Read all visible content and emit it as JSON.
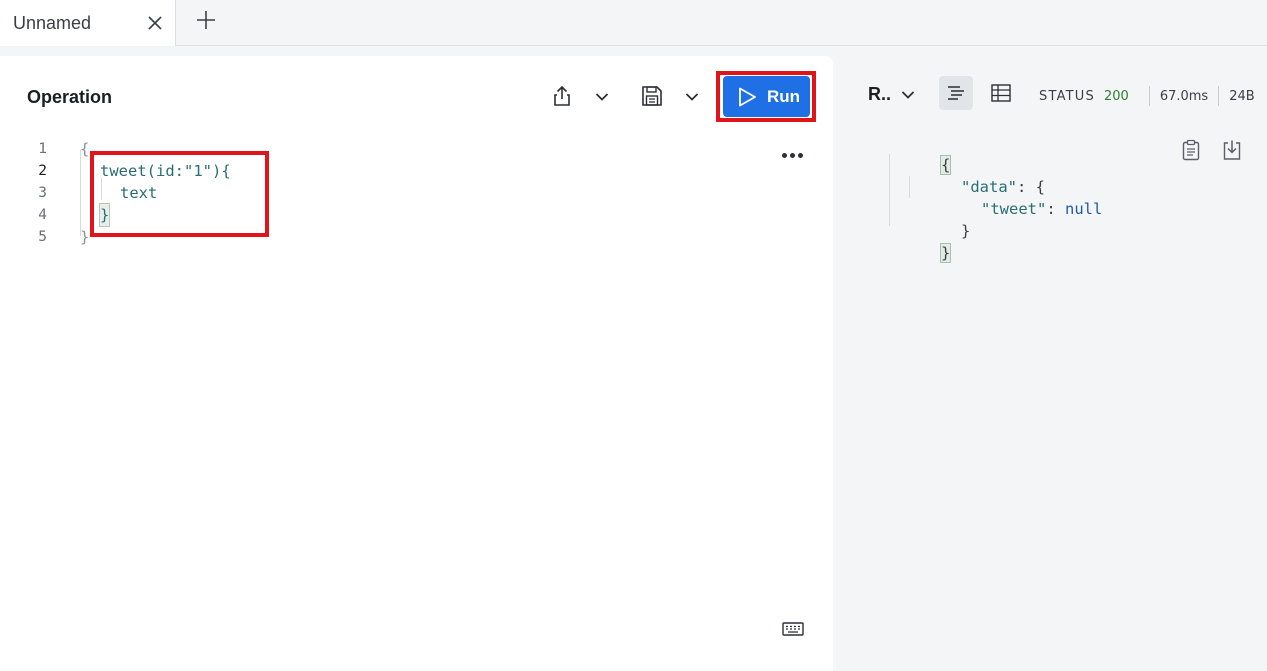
{
  "tabs": [
    {
      "title": "Unnamed",
      "active": true
    }
  ],
  "operation": {
    "title": "Operation",
    "run_label": "Run",
    "lines": [
      {
        "num": "1",
        "text": "{"
      },
      {
        "num": "2",
        "text": "tweet(id:\"1\"){"
      },
      {
        "num": "3",
        "text": "text"
      },
      {
        "num": "4",
        "text": "}"
      },
      {
        "num": "5",
        "text": "}"
      }
    ]
  },
  "response": {
    "selector_label": "R..",
    "status_label": "STATUS",
    "status_code": "200",
    "time": "67.0ms",
    "size": "24B",
    "json_lines": [
      {
        "text": "{"
      },
      {
        "key": "\"data\"",
        "rest": ": {"
      },
      {
        "key": "\"tweet\"",
        "rest": ": ",
        "value": "null"
      },
      {
        "text": "}"
      },
      {
        "text": "}"
      }
    ]
  },
  "icons": [
    "close-icon",
    "plus-icon",
    "share-icon",
    "chevron-down-icon",
    "save-icon",
    "play-icon",
    "more-icon",
    "keyboard-icon",
    "json-view-icon",
    "table-view-icon",
    "clipboard-icon",
    "download-icon"
  ],
  "colors": {
    "accent": "#1f6fe5",
    "highlight": "#e0151b",
    "status_ok": "#2e7d32"
  }
}
